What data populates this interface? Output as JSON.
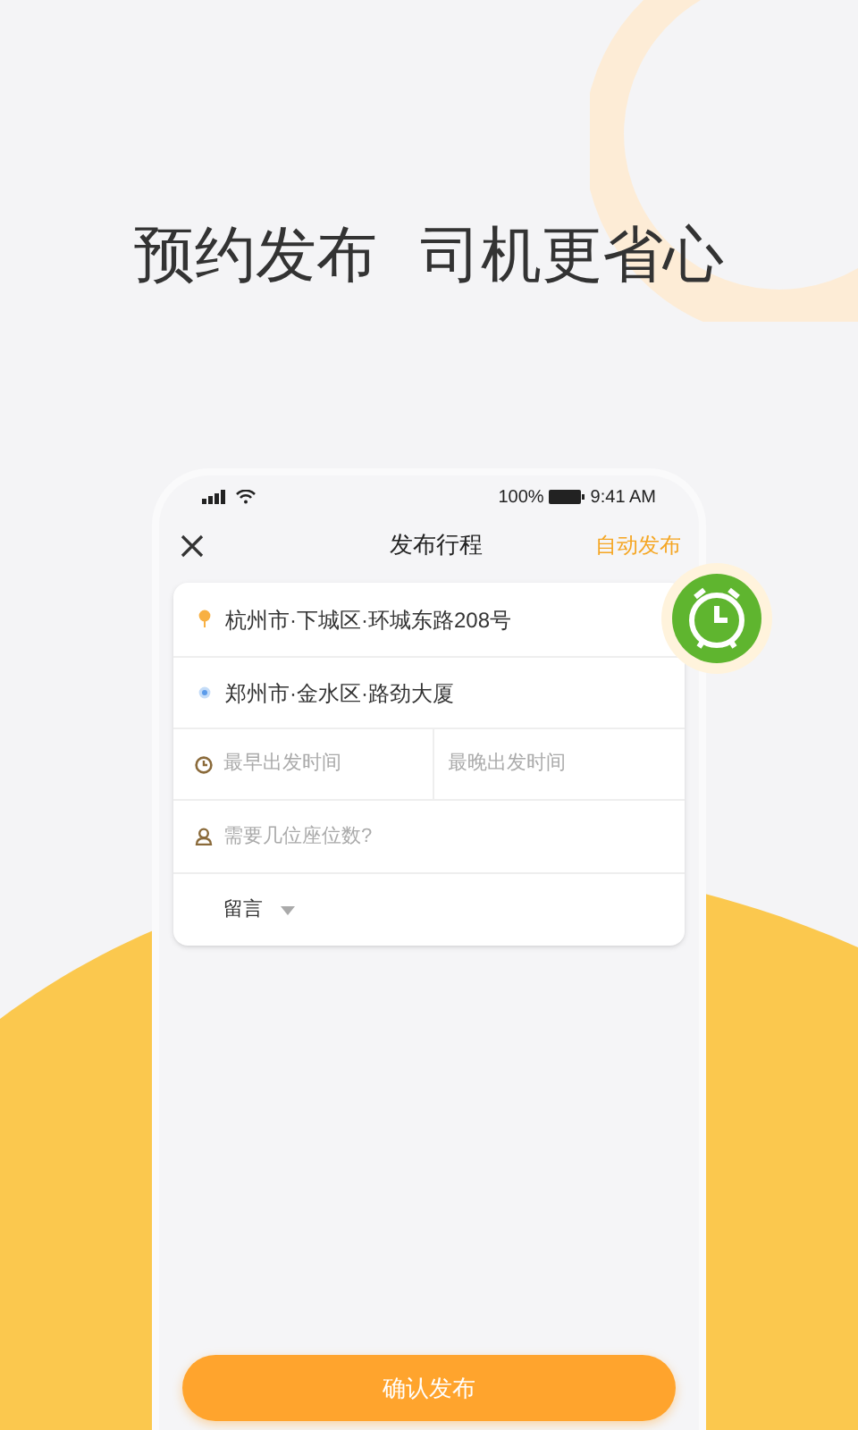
{
  "headline": [
    "预约发布",
    "司机更省心"
  ],
  "status_bar": {
    "battery": "100%",
    "time": "9:41 AM"
  },
  "nav": {
    "title": "发布行程",
    "action": "自动发布"
  },
  "form": {
    "origin": "杭州市·下城区·环城东路208号",
    "destination": "郑州市·金水区·路劲大厦",
    "earliest_placeholder": "最早出发时间",
    "latest_placeholder": "最晚出发时间",
    "seats_placeholder": "需要几位座位数?",
    "message_label": "留言"
  },
  "confirm_button": "确认发布"
}
